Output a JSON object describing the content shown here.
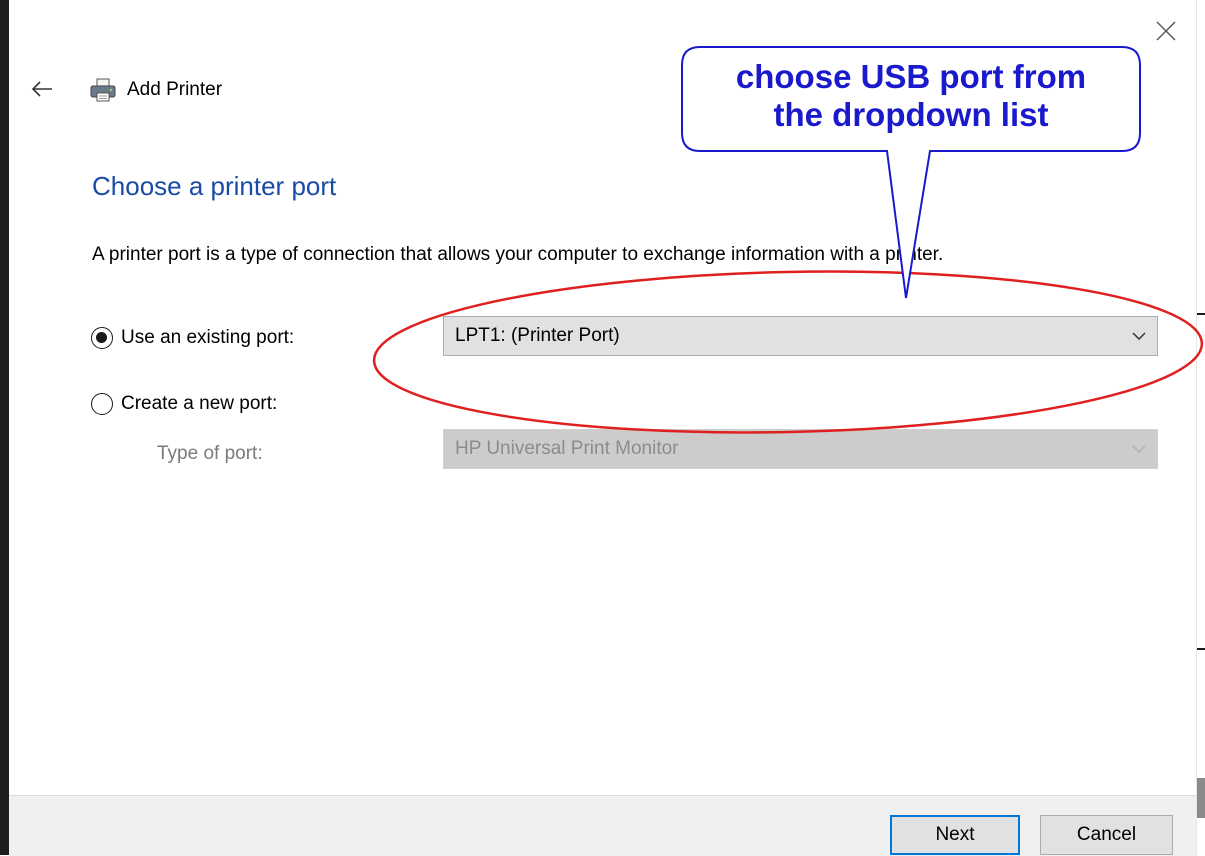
{
  "window": {
    "title": "Add Printer"
  },
  "icons": {
    "close": "close-icon",
    "back": "back-arrow-icon",
    "printer": "printer-icon",
    "dropdown": "chevron-down-icon"
  },
  "page": {
    "title": "Choose a printer port",
    "description": "A printer port is a type of connection that allows your computer to exchange information with a printer."
  },
  "options": {
    "existing_port": {
      "label": "Use an existing port:",
      "selected": true,
      "value": "LPT1: (Printer Port)"
    },
    "new_port": {
      "label": "Create a new port:",
      "selected": false,
      "type_label": "Type of port:",
      "type_value": "HP Universal Print Monitor"
    }
  },
  "buttons": {
    "next": "Next",
    "cancel": "Cancel"
  },
  "annotation": {
    "line1": "choose USB port from",
    "line2": "the dropdown list",
    "callout_color": "#1a1acc",
    "ellipse_color": "#e02020"
  },
  "colors": {
    "title_blue": "#1a4ba6",
    "focus_border": "#0078d7"
  }
}
